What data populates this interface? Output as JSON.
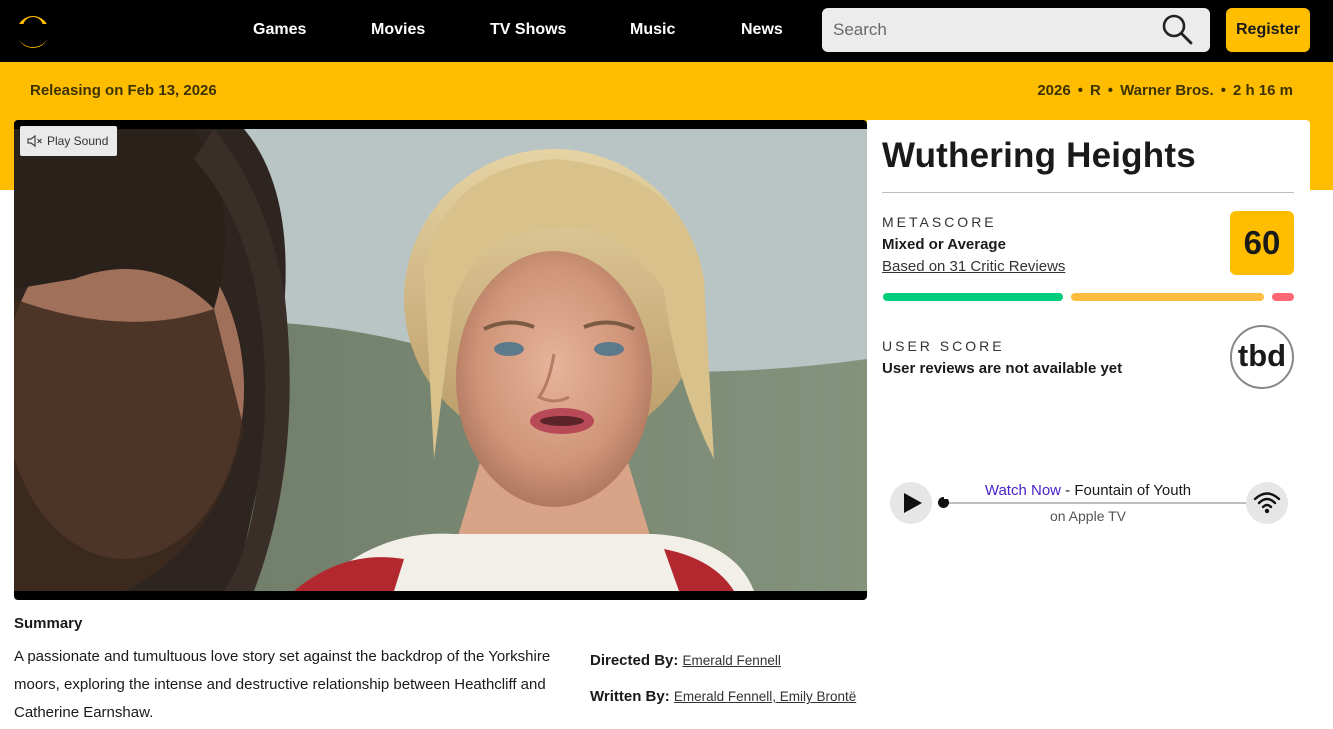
{
  "nav": {
    "links": [
      "Games",
      "Movies",
      "TV Shows",
      "Music",
      "News"
    ],
    "search_placeholder": "Search",
    "register_label": "Register"
  },
  "release": {
    "text": "Releasing on Feb 13, 2026",
    "year": "2026",
    "rating": "R",
    "studio": "Warner Bros.",
    "runtime": "2 h 16 m"
  },
  "video": {
    "sound_label": "Play Sound"
  },
  "movie": {
    "title": "Wuthering Heights"
  },
  "metascore": {
    "label": "METASCORE",
    "verdict": "Mixed or Average",
    "reviews_link": "Based on 31 Critic Reviews",
    "score": "60",
    "distribution_colors": [
      "#00ce7a",
      "#ffbd3f",
      "#ff6874"
    ]
  },
  "user_score": {
    "label": "USER SCORE",
    "verdict": "User reviews are not available yet",
    "score": "tbd"
  },
  "watch": {
    "cta": "Watch Now",
    "separator": " - ",
    "title": "Fountain of Youth",
    "platform": "on Apple TV"
  },
  "summary": {
    "heading": "Summary",
    "text": "A passionate and tumultuous love story set against the backdrop of the Yorkshire moors, exploring the intense and destructive relationship between Heathcliff and Catherine Earnshaw."
  },
  "credits": {
    "directed_label": "Directed By:",
    "director": "Emerald Fennell",
    "written_label": "Written By:",
    "writers": "Emerald Fennell, Emily Brontë"
  },
  "colors": {
    "accent_yellow": "#ffbd00",
    "nav_bg": "#000000",
    "watch_now_purple": "#4a22c7"
  }
}
